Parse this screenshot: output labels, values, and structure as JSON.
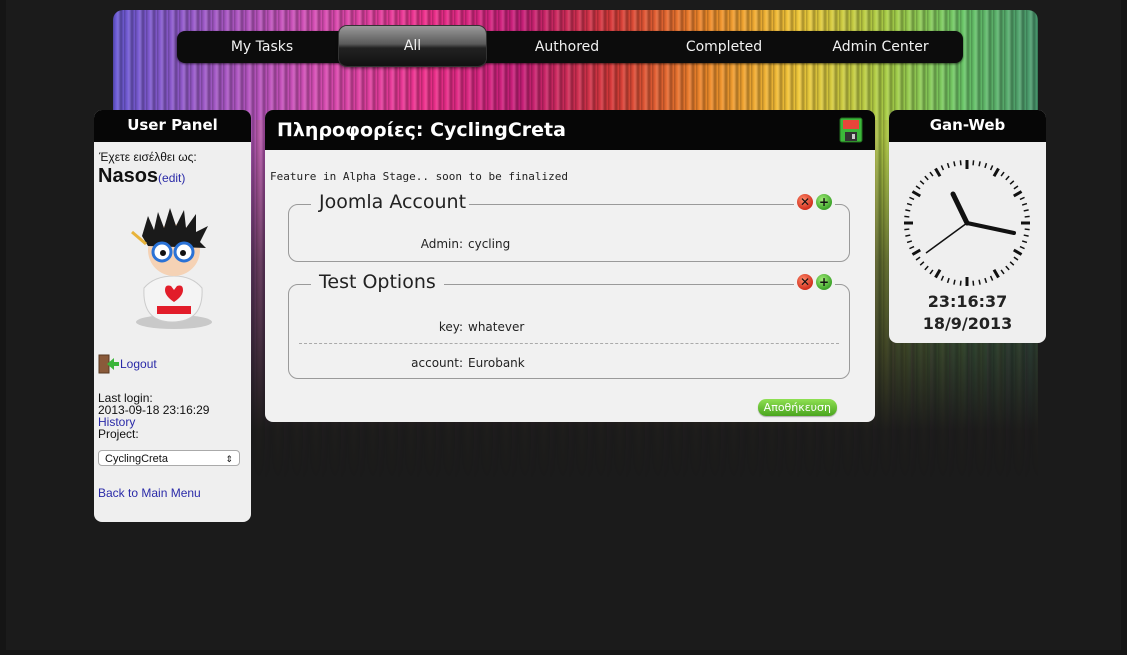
{
  "nav": {
    "items": [
      "My Tasks",
      "All",
      "Authored",
      "Completed",
      "Admin Center"
    ],
    "active": "All"
  },
  "user_panel": {
    "title": "User Panel",
    "logged_in_as": "Έχετε εισέλθει ως:",
    "username": "Nasos",
    "edit_link": "(edit)",
    "logout": "Logout",
    "last_login_label": "Last login:",
    "last_login_value": "2013-09-18 23:16:29",
    "history_link": "History",
    "project_label": "Project:",
    "project_selected": "CyclingCreta",
    "back_link": "Back to Main Menu"
  },
  "main": {
    "title": "Πληροφορίες: CyclingCreta",
    "alpha_notice": "Feature in Alpha Stage.. soon to be finalized",
    "groups": [
      {
        "legend": "Joomla Account",
        "rows": [
          {
            "key": "Admin:",
            "value": "cycling"
          }
        ]
      },
      {
        "legend": "Test Options",
        "rows": [
          {
            "key": "key:",
            "value": "whatever"
          },
          {
            "key": "account:",
            "value": "Eurobank"
          }
        ]
      }
    ],
    "save_button": "Αποθήκευση"
  },
  "clock_panel": {
    "title": "Gan-Web",
    "time": "23:16:37",
    "date": "18/9/2013"
  },
  "colors": {
    "panel_bg": "#efefef",
    "header_bg": "#060606",
    "link": "#2a2aa8",
    "save_green": "#5bb82a"
  }
}
